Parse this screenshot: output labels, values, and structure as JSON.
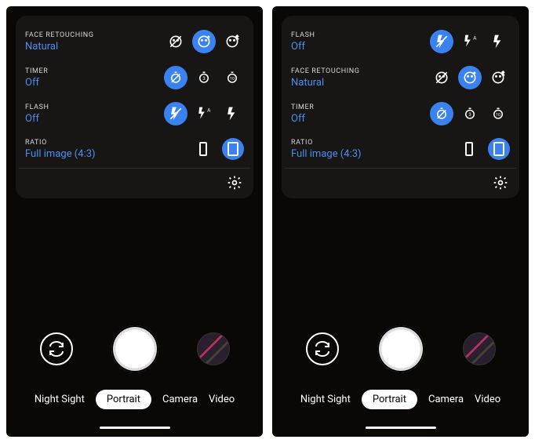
{
  "accent": "#3a82f0",
  "left": {
    "settings": [
      {
        "key": "face",
        "title": "FACE RETOUCHING",
        "value": "Natural",
        "options": [
          "off",
          "natural",
          "heavy"
        ],
        "selectedIndex": 1
      },
      {
        "key": "timer",
        "title": "TIMER",
        "value": "Off",
        "options": [
          "off",
          "3s",
          "10s"
        ],
        "selectedIndex": 0
      },
      {
        "key": "flash",
        "title": "FLASH",
        "value": "Off",
        "options": [
          "off",
          "auto",
          "on"
        ],
        "selectedIndex": 0
      },
      {
        "key": "ratio",
        "title": "RATIO",
        "value": "Full image (4:3)",
        "options": [
          "3:4",
          "4:3"
        ],
        "selectedIndex": 1
      }
    ],
    "modes": [
      "Night Sight",
      "Portrait",
      "Camera",
      "Video"
    ],
    "activeModeIndex": 1
  },
  "right": {
    "settings": [
      {
        "key": "flash",
        "title": "FLASH",
        "value": "Off",
        "options": [
          "off",
          "auto",
          "on"
        ],
        "selectedIndex": 0
      },
      {
        "key": "face",
        "title": "FACE RETOUCHING",
        "value": "Natural",
        "options": [
          "off",
          "natural",
          "heavy"
        ],
        "selectedIndex": 1
      },
      {
        "key": "timer",
        "title": "TIMER",
        "value": "Off",
        "options": [
          "off",
          "3s",
          "10s"
        ],
        "selectedIndex": 0
      },
      {
        "key": "ratio",
        "title": "RATIO",
        "value": "Full image (4:3)",
        "options": [
          "3:4",
          "4:3"
        ],
        "selectedIndex": 1
      }
    ],
    "modes": [
      "Night Sight",
      "Portrait",
      "Camera",
      "Video"
    ],
    "activeModeIndex": 1
  }
}
